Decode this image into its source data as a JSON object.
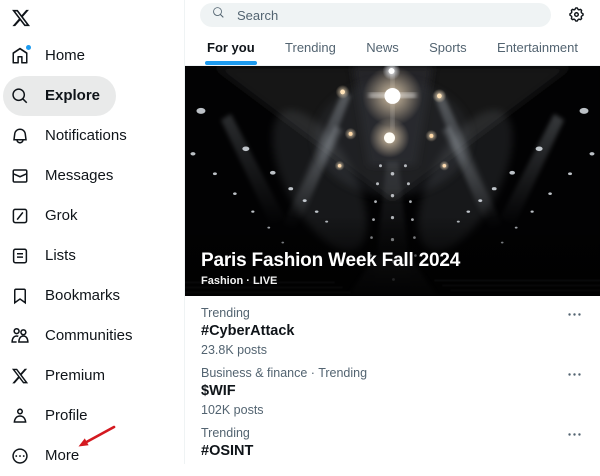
{
  "app": {
    "name": "X"
  },
  "colors": {
    "accent": "#1d9bf0",
    "text_primary": "#0f1419",
    "text_secondary": "#536471",
    "search_bg": "#eff3f4",
    "active_pill_bg": "#e9eaea",
    "annotation_arrow": "#d41920"
  },
  "sidebar": {
    "logo_icon": "x-logo-icon",
    "items": [
      {
        "label": "Home",
        "icon": "home-icon",
        "has_badge": true
      },
      {
        "label": "Explore",
        "icon": "search-icon",
        "active": true
      },
      {
        "label": "Notifications",
        "icon": "bell-icon"
      },
      {
        "label": "Messages",
        "icon": "envelope-icon"
      },
      {
        "label": "Grok",
        "icon": "grok-icon"
      },
      {
        "label": "Lists",
        "icon": "list-icon"
      },
      {
        "label": "Bookmarks",
        "icon": "bookmark-icon"
      },
      {
        "label": "Communities",
        "icon": "people-icon"
      },
      {
        "label": "Premium",
        "icon": "x-icon"
      },
      {
        "label": "Profile",
        "icon": "person-icon"
      },
      {
        "label": "More",
        "icon": "more-circle-icon"
      }
    ]
  },
  "header": {
    "search_placeholder": "Search",
    "settings_icon": "gear-icon"
  },
  "tabs": [
    {
      "label": "For you",
      "active": true
    },
    {
      "label": "Trending",
      "active": false
    },
    {
      "label": "News",
      "active": false
    },
    {
      "label": "Sports",
      "active": false
    },
    {
      "label": "Entertainment",
      "active": false
    }
  ],
  "hero": {
    "title": "Paris Fashion Week Fall 2024",
    "category": "Fashion",
    "status": "LIVE",
    "meta": "Fashion · LIVE"
  },
  "trends": [
    {
      "context": "Trending",
      "topic": "#CyberAttack",
      "posts": "23.8K posts",
      "more_icon": "ellipsis-icon"
    },
    {
      "context": "Business & finance · Trending",
      "topic": "$WIF",
      "posts": "102K posts",
      "more_icon": "ellipsis-icon"
    },
    {
      "context": "Trending",
      "topic": "#OSINT",
      "posts": "",
      "more_icon": "ellipsis-icon"
    }
  ]
}
